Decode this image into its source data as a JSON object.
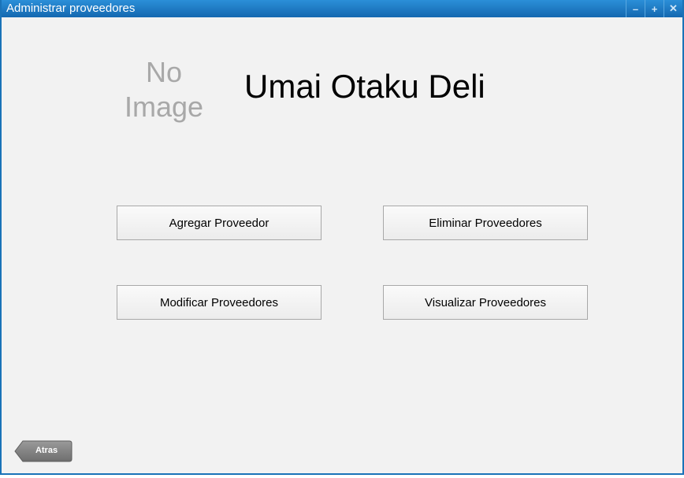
{
  "window": {
    "title": "Administrar proveedores",
    "controls": {
      "minimize": "–",
      "maximize": "+",
      "close": "✕"
    }
  },
  "header": {
    "logo_line1": "No",
    "logo_line2": "Image",
    "brand_name": "Umai Otaku Deli"
  },
  "actions": {
    "add": "Agregar Proveedor",
    "delete": "Eliminar Proveedores",
    "modify": "Modificar Proveedores",
    "view": "Visualizar Proveedores"
  },
  "footer": {
    "back_label": "Atras"
  },
  "colors": {
    "titlebar": "#1a73b8",
    "background": "#f2f2f2",
    "back_button": "#7d7d7d"
  }
}
